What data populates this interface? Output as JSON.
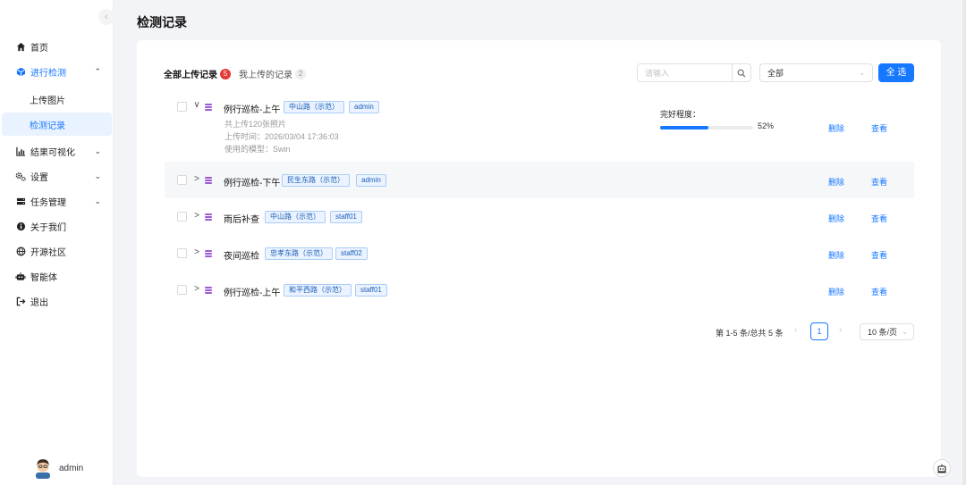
{
  "sidebar": {
    "collapse_icon": "chevron-left-icon",
    "items": [
      {
        "label": "首页",
        "icon": "home-icon"
      },
      {
        "label": "进行检测",
        "icon": "cube-icon"
      },
      {
        "label": "结果可视化",
        "icon": "chart-icon"
      },
      {
        "label": "设置",
        "icon": "gears-icon"
      },
      {
        "label": "任务管理",
        "icon": "server-icon"
      },
      {
        "label": "关于我们",
        "icon": "info-icon"
      },
      {
        "label": "开源社区",
        "icon": "globe-icon"
      },
      {
        "label": "智能体",
        "icon": "robot-icon"
      },
      {
        "label": "退出",
        "icon": "logout-icon"
      }
    ],
    "sub_items": [
      {
        "label": "上传图片"
      },
      {
        "label": "检测记录"
      }
    ],
    "user": {
      "name": "admin"
    }
  },
  "page": {
    "title": "检测记录"
  },
  "tabs": [
    {
      "label": "全部上传记录",
      "count": "5"
    },
    {
      "label": "我上传的记录",
      "count": "2"
    }
  ],
  "toolbar": {
    "search_placeholder": "请输入",
    "filter_value": "全部",
    "select_all_label": "全 选"
  },
  "records": [
    {
      "title": "例行巡检-上午",
      "road": "中山路（示范）",
      "user": "admin",
      "expanded": true,
      "photo_count": "共上传120张照片",
      "upload_time": "上传时间：2026/03/04 17:36:03",
      "model": "使用的模型：Swin",
      "progress_label": "完好程度：",
      "progress_value": 52,
      "progress_text": "52%"
    },
    {
      "title": "例行巡检-下午",
      "road": "民生东路（示范）",
      "user": "admin"
    },
    {
      "title": "雨后补查",
      "road": "中山路（示范）",
      "user": "staff01"
    },
    {
      "title": "夜间巡检",
      "road": "忠孝东路（示范）",
      "user": "staff02"
    },
    {
      "title": "例行巡检-上午",
      "road": "和平西路（示范）",
      "user": "staff01"
    }
  ],
  "actions": {
    "delete": "删除",
    "view": "查看"
  },
  "pagination": {
    "summary": "第 1-5 条/总共 5 条",
    "current_page": "1",
    "page_size": "10 条/页"
  },
  "colors": {
    "primary": "#1677ff",
    "danger": "#e53935",
    "tag_bg": "#eaf3ff"
  }
}
